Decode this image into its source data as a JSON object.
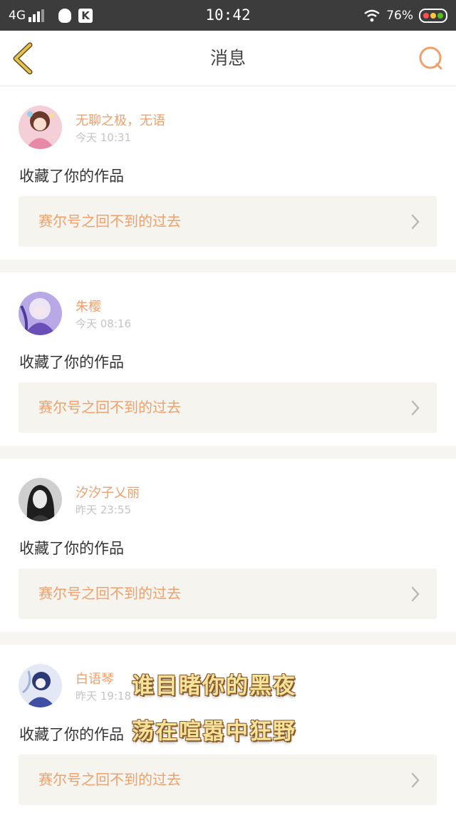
{
  "status_bar": {
    "network": "4G",
    "time": "10:42",
    "battery_percent": "76%",
    "icons": [
      "signal-icon",
      "qq-icon",
      "k-app-icon",
      "wifi-icon",
      "battery-icon"
    ]
  },
  "header": {
    "title": "消息",
    "back_icon": "chevron-left-icon",
    "search_icon": "search-icon",
    "accent_color": "#f0a06c",
    "back_color": "#e0b84a"
  },
  "messages": [
    {
      "username": "无聊之极，无语",
      "time": "今天 10:31",
      "action": "收藏了你的作品",
      "work_title": "赛尔号之回不到的过去"
    },
    {
      "username": "朱樱",
      "time": "今天 08:16",
      "action": "收藏了你的作品",
      "work_title": "赛尔号之回不到的过去"
    },
    {
      "username": "汐汐子乂丽",
      "time": "昨天 23:55",
      "action": "收藏了你的作品",
      "work_title": "赛尔号之回不到的过去"
    },
    {
      "username": "白语琴",
      "time": "昨天 19:18",
      "action": "收藏了你的作品",
      "work_title": "赛尔号之回不到的过去"
    }
  ],
  "overlay_text": {
    "line1": "谁目睹你的黑夜",
    "line2": "荡在喧嚣中狂野"
  }
}
